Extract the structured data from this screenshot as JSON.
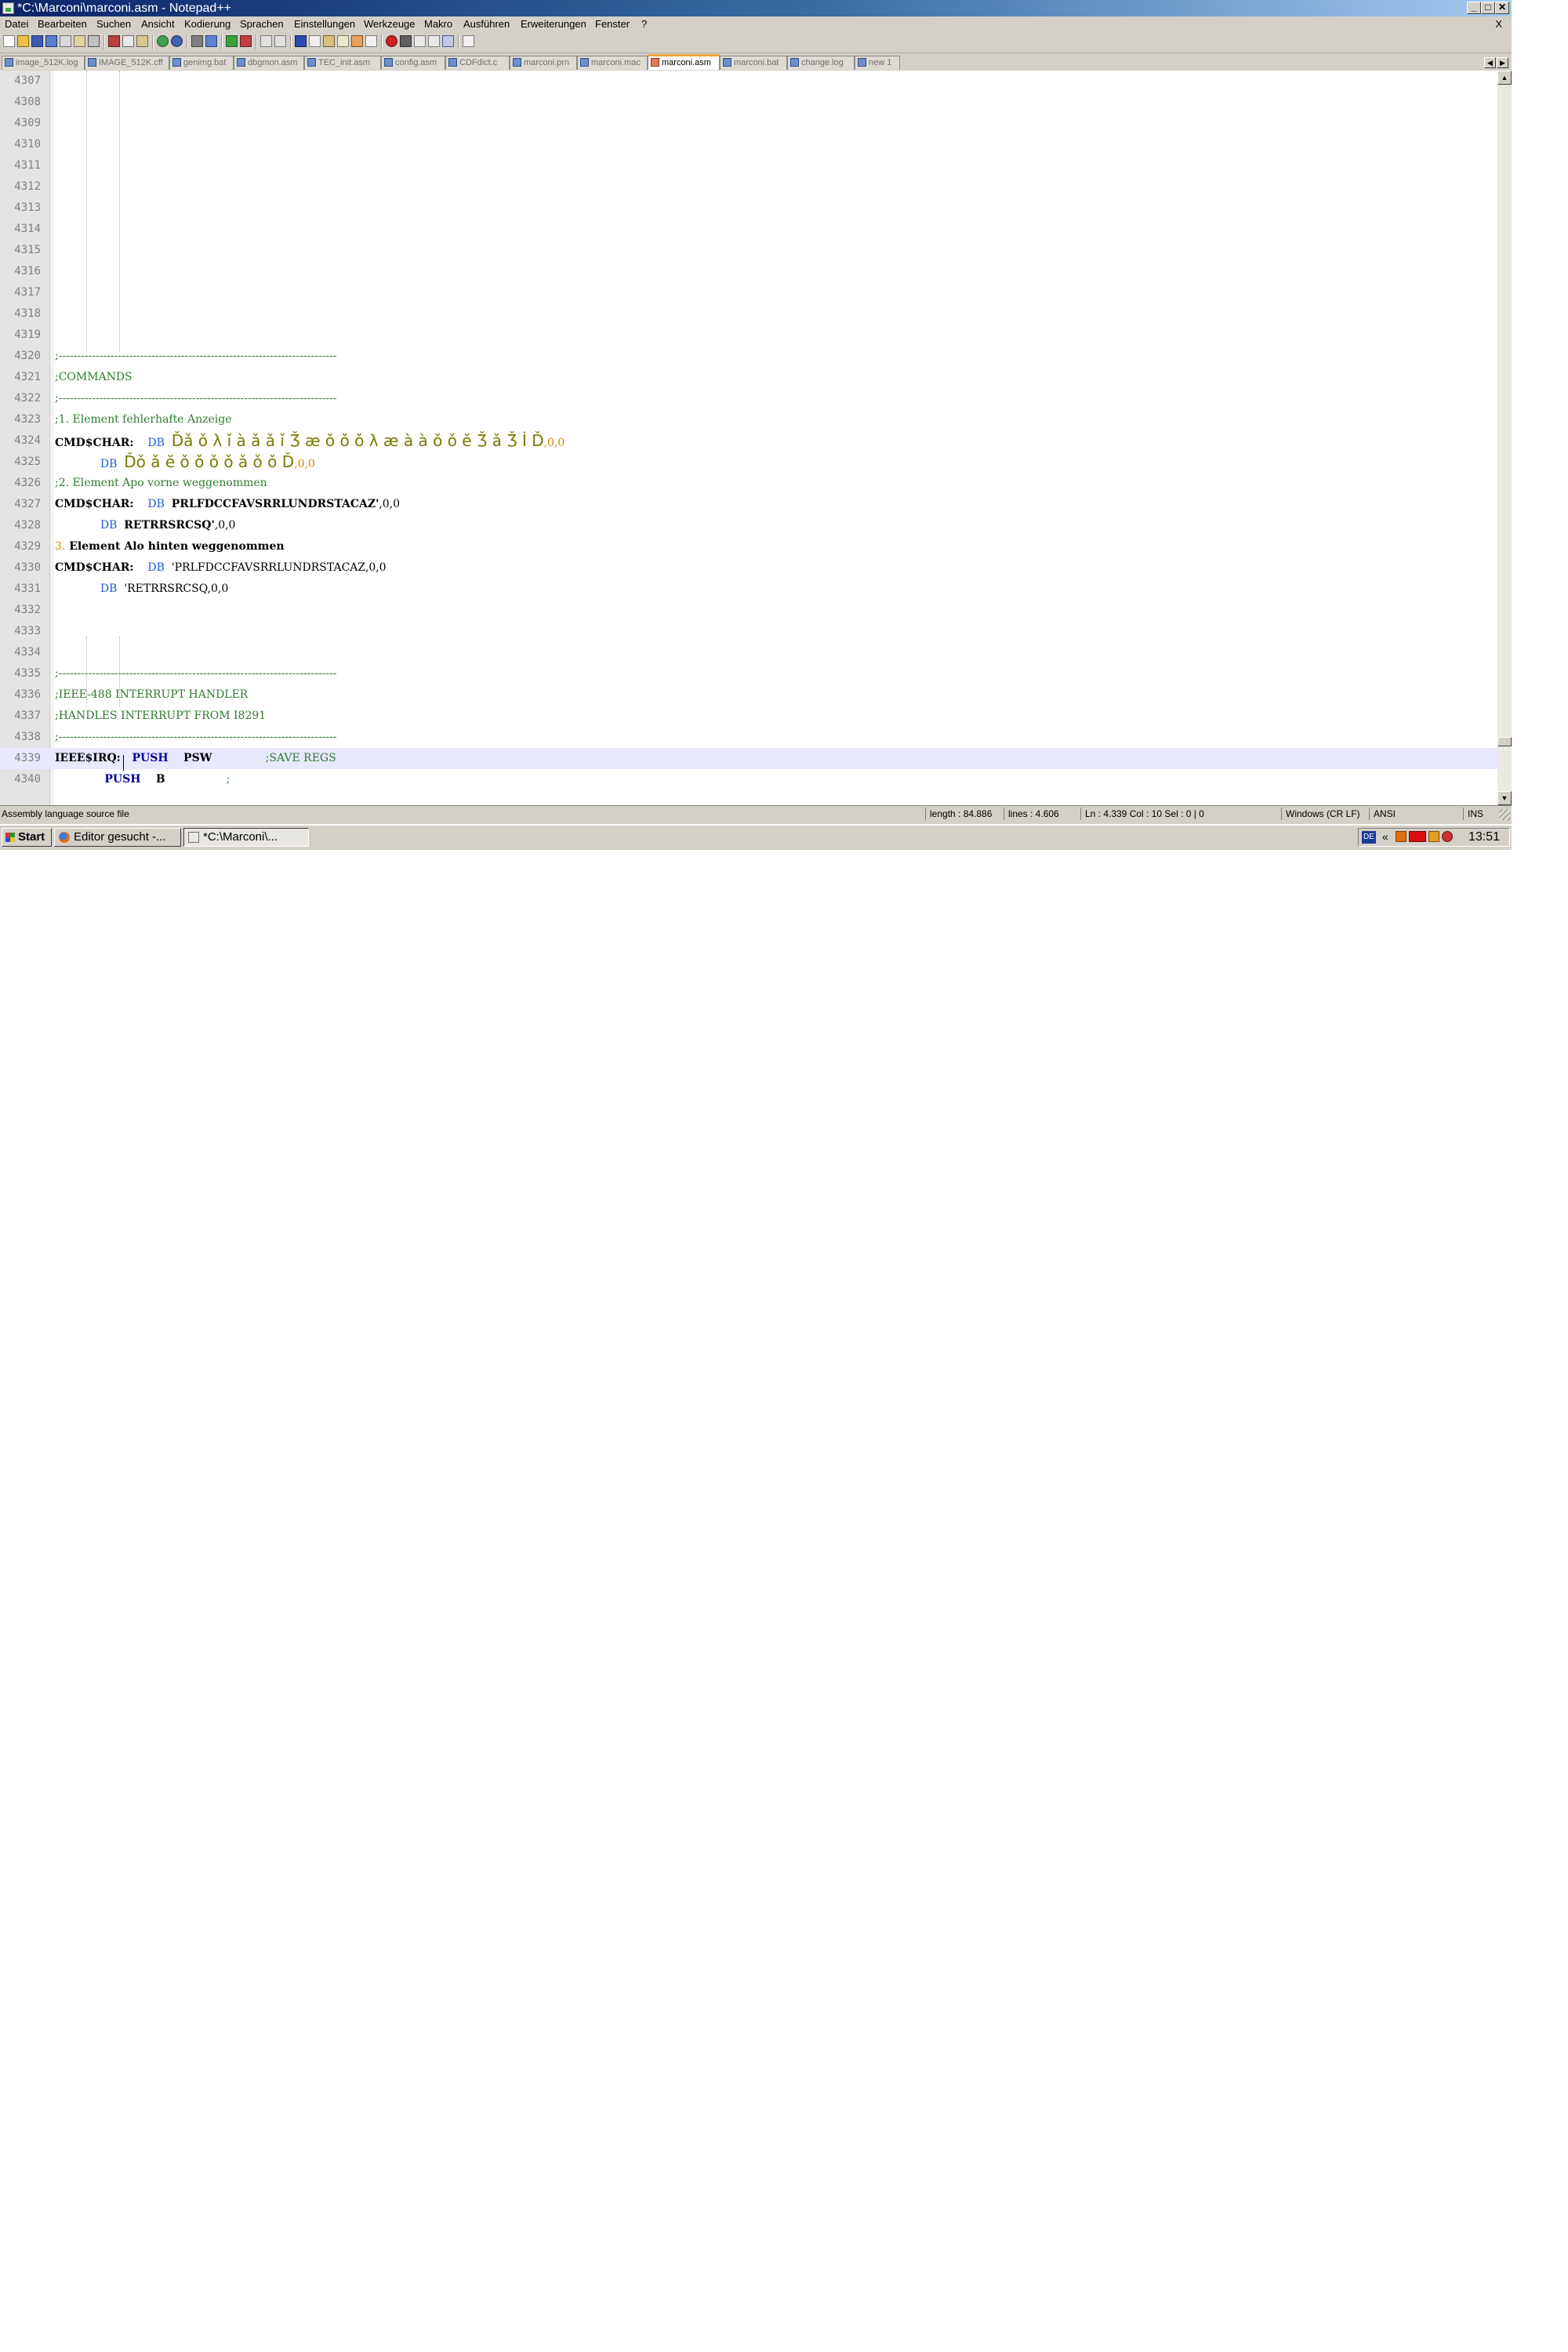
{
  "window": {
    "title": "*C:\\Marconi\\marconi.asm - Notepad++",
    "controls": [
      "_",
      "□",
      "✕"
    ]
  },
  "menu": {
    "items": [
      "Datei",
      "Bearbeiten",
      "Suchen",
      "Ansicht",
      "Kodierung",
      "Sprachen",
      "Einstellungen",
      "Werkzeuge",
      "Makro",
      "Ausführen",
      "Erweiterungen",
      "Fenster",
      "?"
    ],
    "close_label": "X"
  },
  "tabs": [
    {
      "label": "image_512K.log"
    },
    {
      "label": "IMAGE_512K.cff"
    },
    {
      "label": "genimg.bat"
    },
    {
      "label": "dbgmon.asm"
    },
    {
      "label": "TEC_init.asm"
    },
    {
      "label": "config.asm"
    },
    {
      "label": "CDFdict.c"
    },
    {
      "label": "marconi.prn"
    },
    {
      "label": "marconi.mac"
    },
    {
      "label": "marconi.asm",
      "active": true
    },
    {
      "label": "marconi.bat"
    },
    {
      "label": "change.log"
    },
    {
      "label": "new 1"
    }
  ],
  "editor": {
    "lines": [
      {
        "no": "4307"
      },
      {
        "no": "4308"
      },
      {
        "no": "4309"
      },
      {
        "no": "4310"
      },
      {
        "no": "4311"
      },
      {
        "no": "4312"
      },
      {
        "no": "4313"
      },
      {
        "no": "4314"
      },
      {
        "no": "4315"
      },
      {
        "no": "4316"
      },
      {
        "no": "4317"
      },
      {
        "no": "4318"
      },
      {
        "no": "4319"
      },
      {
        "no": "4320",
        "tokens": [
          {
            "t": ";---------------------------------------------------------------------------",
            "c": "comment"
          }
        ]
      },
      {
        "no": "4321",
        "tokens": [
          {
            "t": ";COMMANDS",
            "c": "comment"
          }
        ]
      },
      {
        "no": "4322",
        "tokens": [
          {
            "t": ";---------------------------------------------------------------------------",
            "c": "comment"
          }
        ]
      },
      {
        "no": "4323",
        "tokens": [
          {
            "t": ";1. Element fehlerhafte Anzeige",
            "c": "comment"
          }
        ]
      },
      {
        "no": "4324",
        "tokens": [
          {
            "t": "CMD$CHAR:",
            "c": "label"
          },
          {
            "t": "    DB  ",
            "c": "instr"
          },
          {
            "t": "Ďǎ ǒ λ ǐ à ǎ ǎ ǐ Ǯ æ ǒ ǒ ǒ λ æ à à ǒ ǒ ĕ Ǯ ǎ Ǯ İ Ď",
            "c": "garbled"
          },
          {
            "t": ",0,0",
            "c": "num"
          }
        ]
      },
      {
        "no": "4325",
        "tokens": [
          {
            "t": "             DB  ",
            "c": "instr"
          },
          {
            "t": "Ďǒ ǎ ĕ ǒ ǒ ǒ ǒ ǎ ǒ ǒ Ď",
            "c": "garbled"
          },
          {
            "t": ",0,0",
            "c": "num"
          }
        ]
      },
      {
        "no": "4326",
        "tokens": [
          {
            "t": ";2. Element Apo vorne weggenommen",
            "c": "comment"
          }
        ]
      },
      {
        "no": "4327",
        "tokens": [
          {
            "t": "CMD$CHAR:",
            "c": "label"
          },
          {
            "t": "    DB  ",
            "c": "instr"
          },
          {
            "t": "PRLFDCCFAVSRRLUNDRSTACAZ'",
            "c": "bold"
          },
          {
            "t": ",0,0",
            "c": "plain"
          }
        ]
      },
      {
        "no": "4328",
        "tokens": [
          {
            "t": "             DB  ",
            "c": "instr"
          },
          {
            "t": "RETRRSRCSQ'",
            "c": "bold"
          },
          {
            "t": ",0,0",
            "c": "plain"
          }
        ]
      },
      {
        "no": "4329",
        "tokens": [
          {
            "t": "3.",
            "c": "num"
          },
          {
            "t": " Element Alo hinten weggenommen",
            "c": "bold"
          }
        ]
      },
      {
        "no": "4330",
        "tokens": [
          {
            "t": "CMD$CHAR:",
            "c": "label"
          },
          {
            "t": "    DB  ",
            "c": "instr"
          },
          {
            "t": "'PRLFDCCFAVSRRLUNDRSTACAZ,0,0",
            "c": "plain"
          }
        ]
      },
      {
        "no": "4331",
        "tokens": [
          {
            "t": "             DB  ",
            "c": "instr"
          },
          {
            "t": "'RETRRSRCSQ,0,0",
            "c": "plain"
          }
        ]
      },
      {
        "no": "4332"
      },
      {
        "no": "4333"
      },
      {
        "no": "4334"
      },
      {
        "no": "4335",
        "tokens": [
          {
            "t": ";---------------------------------------------------------------------------",
            "c": "comment"
          }
        ]
      },
      {
        "no": "4336",
        "tokens": [
          {
            "t": ";IEEE-488 INTERRUPT HANDLER",
            "c": "comment"
          }
        ]
      },
      {
        "no": "4337",
        "tokens": [
          {
            "t": ";HANDLES INTERRUPT FROM I8291",
            "c": "comment"
          }
        ]
      },
      {
        "no": "4338",
        "tokens": [
          {
            "t": ";---------------------------------------------------------------------------",
            "c": "comment"
          }
        ]
      },
      {
        "no": "4339",
        "current": true,
        "tokens": [
          {
            "t": "IEEE$IRQ:",
            "c": "label"
          },
          {
            "t": "   PUSH",
            "c": "push"
          },
          {
            "t": "    PSW              ",
            "c": "bold"
          },
          {
            "t": ";SAVE REGS",
            "c": "comment"
          }
        ]
      },
      {
        "no": "4340",
        "tokens": [
          {
            "t": "             PUSH",
            "c": "push"
          },
          {
            "t": "    B                ",
            "c": "bold"
          },
          {
            "t": ";",
            "c": "comment"
          }
        ]
      }
    ]
  },
  "status": {
    "file_type": "Assembly language source file",
    "length": "length : 84.886",
    "lines": "lines : 4.606",
    "position": "Ln : 4.339    Col : 10    Sel : 0 | 0",
    "eol": "Windows (CR LF)",
    "encoding": "ANSI",
    "mode": "INS"
  },
  "taskbar": {
    "start_label": "Start",
    "tasks": [
      {
        "label": "Editor gesucht -..."
      },
      {
        "label": "*C:\\Marconi\\...",
        "active": true
      }
    ],
    "lang": "DE",
    "tray_arrow": "«",
    "clock": "13:51"
  },
  "colors": {
    "title_bar": "#0a246a",
    "active_tab_accent": "#f0a33a",
    "comment": "#2e7d2e",
    "instruction": "#1e5ad8",
    "number": "#d08800",
    "current_line": "#e8e8ff"
  }
}
